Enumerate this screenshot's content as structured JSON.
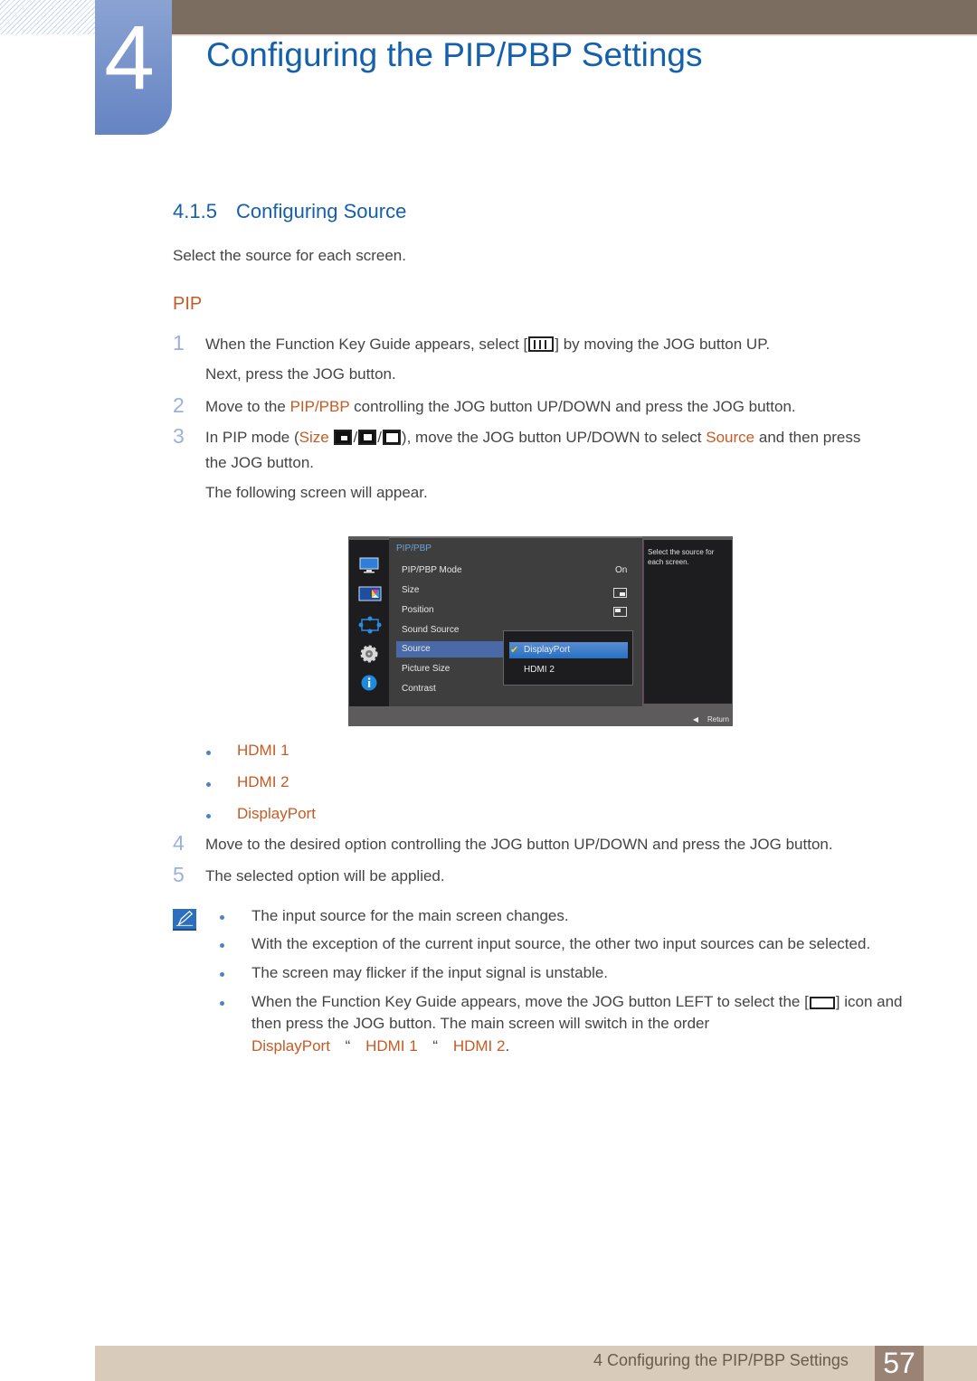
{
  "chapter": {
    "number": "4",
    "title": "Configuring the PIP/PBP Settings"
  },
  "section": {
    "number": "4.1.5",
    "title": "Configuring Source",
    "intro": "Select the source for each screen."
  },
  "subsection": {
    "title": "PIP"
  },
  "steps": {
    "s1": {
      "num": "1",
      "text_a": "When the Function Key Guide appears, select [",
      "icon": "menu-icon",
      "text_b": "] by moving the JOG button UP.",
      "line2": "Next, press the JOG button."
    },
    "s2": {
      "num": "2",
      "text_a": "Move to the ",
      "highlight": "PIP/PBP",
      "text_b": " controlling the JOG button UP/DOWN and press the JOG button."
    },
    "s3": {
      "num": "3",
      "text_a": "In PIP mode (",
      "highlight1": "Size",
      "sep": "/",
      "text_b": "), move the JOG button UP/DOWN to select ",
      "highlight2": "Source",
      "text_c": " and then press",
      "line2": "the JOG button.",
      "line3": "The following screen will appear."
    },
    "s4": {
      "num": "4",
      "text": "Move to the desired option controlling the JOG button UP/DOWN and press the JOG button."
    },
    "s5": {
      "num": "5",
      "text": "The selected option will be applied."
    }
  },
  "options": [
    "HDMI 1",
    "HDMI 2",
    "DisplayPort"
  ],
  "osd": {
    "menu_title": "PIP/PBP",
    "items": [
      {
        "label": "PIP/PBP Mode",
        "value": "On"
      },
      {
        "label": "Size",
        "value_icon": "pip-size-icon"
      },
      {
        "label": "Position",
        "value_icon": "pip-position-icon"
      },
      {
        "label": "Sound Source"
      },
      {
        "label": "Source",
        "selected": true
      },
      {
        "label": "Picture Size"
      },
      {
        "label": "Contrast"
      }
    ],
    "submenu": [
      {
        "label": "DisplayPort",
        "selected": true
      },
      {
        "label": "HDMI 2"
      }
    ],
    "help_text": "Select the source for each screen.",
    "return_label": "Return",
    "left_icons": [
      "monitor-icon",
      "color-icon",
      "resize-icon",
      "settings-gear-icon",
      "info-icon"
    ]
  },
  "notes": {
    "n1": "The input source for the main screen changes.",
    "n2": "With the exception of the current input source, the other two input sources can be selected.",
    "n3": "The screen may flicker if the input signal is unstable.",
    "n4_a": "When the Function Key Guide appears, move the JOG button LEFT to select the [",
    "n4_b": "] icon and",
    "n4_line2": "then press the JOG button. The main screen will switch in the order",
    "order": [
      "DisplayPort",
      "HDMI 1",
      "HDMI 2"
    ],
    "order_sep": "“",
    "order_end": "."
  },
  "footer": {
    "chapter_label": "4 Configuring the PIP/PBP Settings",
    "page_number": "57"
  },
  "colors": {
    "heading_blue": "#1560ab",
    "accent_orange": "#c75a24",
    "step_number": "#9ab0e0",
    "top_bar": "#7b6d60",
    "footer_bar": "#d8cbb9",
    "page_badge": "#9a8374"
  }
}
